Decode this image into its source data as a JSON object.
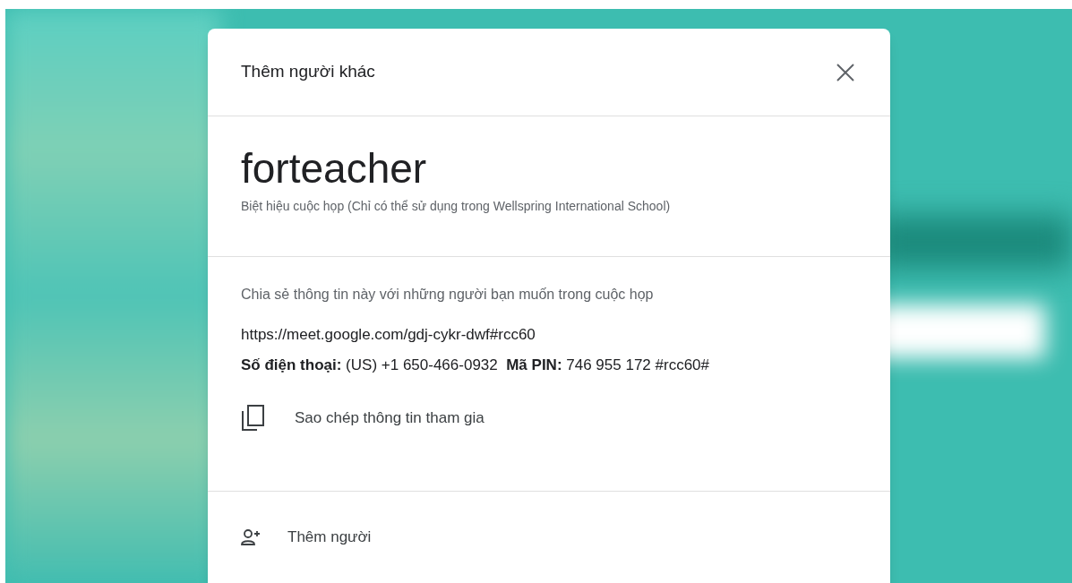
{
  "dialog": {
    "title": "Thêm người khác",
    "meeting_nickname": "forteacher",
    "nickname_note": "Biệt hiệu cuộc họp (Chỉ có thể sử dụng trong Wellspring International School)",
    "share_hint": "Chia sẻ thông tin này với những người bạn muốn trong cuộc họp",
    "meeting_link": "https://meet.google.com/gdj-cykr-dwf#rcc60",
    "dial_in": "**Số điện thoại:** (US) +1 650-466-0932  **Mã PIN:** 746 955 172 #rcc60#",
    "copy_action": "Sao chép thông tin tham gia",
    "add_people_action": "Thêm người"
  }
}
